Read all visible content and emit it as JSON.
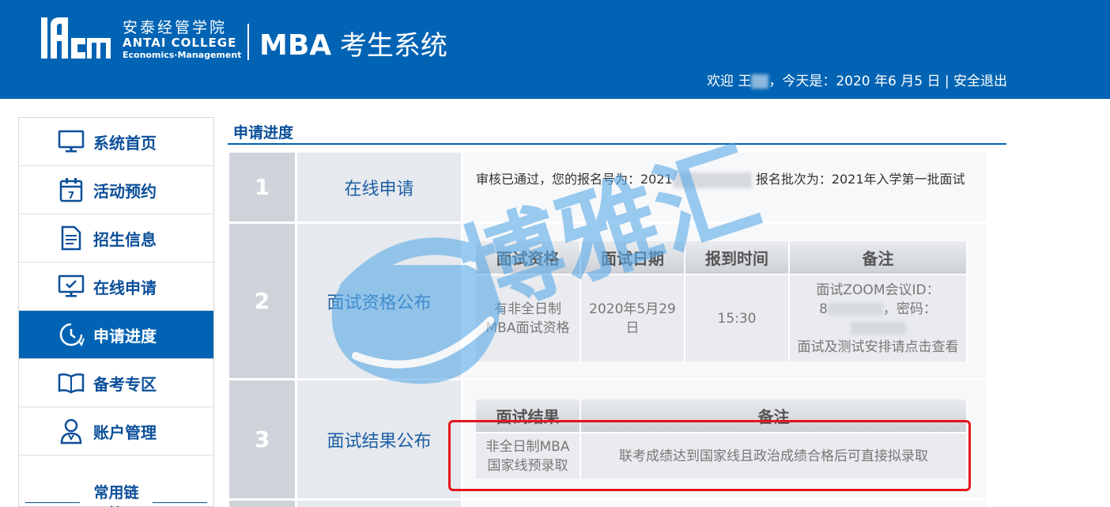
{
  "header": {
    "logo_text": "ACEM",
    "brand_cn": "安泰经管学院",
    "brand_en": "ANTAI COLLEGE",
    "brand_en2": "Economics·Management",
    "system_title_prefix": "MBA",
    "system_title_suffix": " 考生系统",
    "welcome_prefix": "欢迎 王",
    "welcome_date": "，今天是：2020 年6 月5 日 | ",
    "logout_label": "安全退出"
  },
  "sidebar": {
    "items": [
      {
        "label": "系统首页",
        "icon": "monitor-icon"
      },
      {
        "label": "活动预约",
        "icon": "calendar-icon"
      },
      {
        "label": "招生信息",
        "icon": "document-icon"
      },
      {
        "label": "在线申请",
        "icon": "screen-check-icon"
      },
      {
        "label": "申请进度",
        "icon": "clock-icon",
        "active": true
      },
      {
        "label": "备考专区",
        "icon": "book-icon"
      },
      {
        "label": "账户管理",
        "icon": "user-icon"
      }
    ],
    "links_title": "常用链接"
  },
  "main": {
    "section_title": "申请进度",
    "steps": [
      {
        "num": "1",
        "name": "在线申请",
        "text_a": "审核已通过，您的报名号为：2021",
        "text_b": "  报名批次为：2021年入学第一批面试"
      },
      {
        "num": "2",
        "name": "面试资格公布",
        "headers": [
          "面试资格",
          "面试日期",
          "报到时间",
          "备注"
        ],
        "row": {
          "qualification": "有非全日制MBA面试资格",
          "date": "2020年5月29日",
          "time": "15:30",
          "note_a": "面试ZOOM会议ID：",
          "note_b": "8",
          "note_c": "，密码：",
          "note_d": "面试及测试安排请点击查看"
        }
      },
      {
        "num": "3",
        "name": "面试结果公布",
        "headers": [
          "面试结果",
          "备注"
        ],
        "row": {
          "result": "非全日制MBA国家线预录取",
          "note": "联考成绩达到国家线且政治成绩合格后可直接拟录取"
        }
      }
    ]
  },
  "watermark": {
    "text": "博雅汇"
  },
  "colors": {
    "brand_blue": "#0063b3",
    "highlight_red": "#e4161c",
    "watermark_blue": "#5aaae8"
  }
}
